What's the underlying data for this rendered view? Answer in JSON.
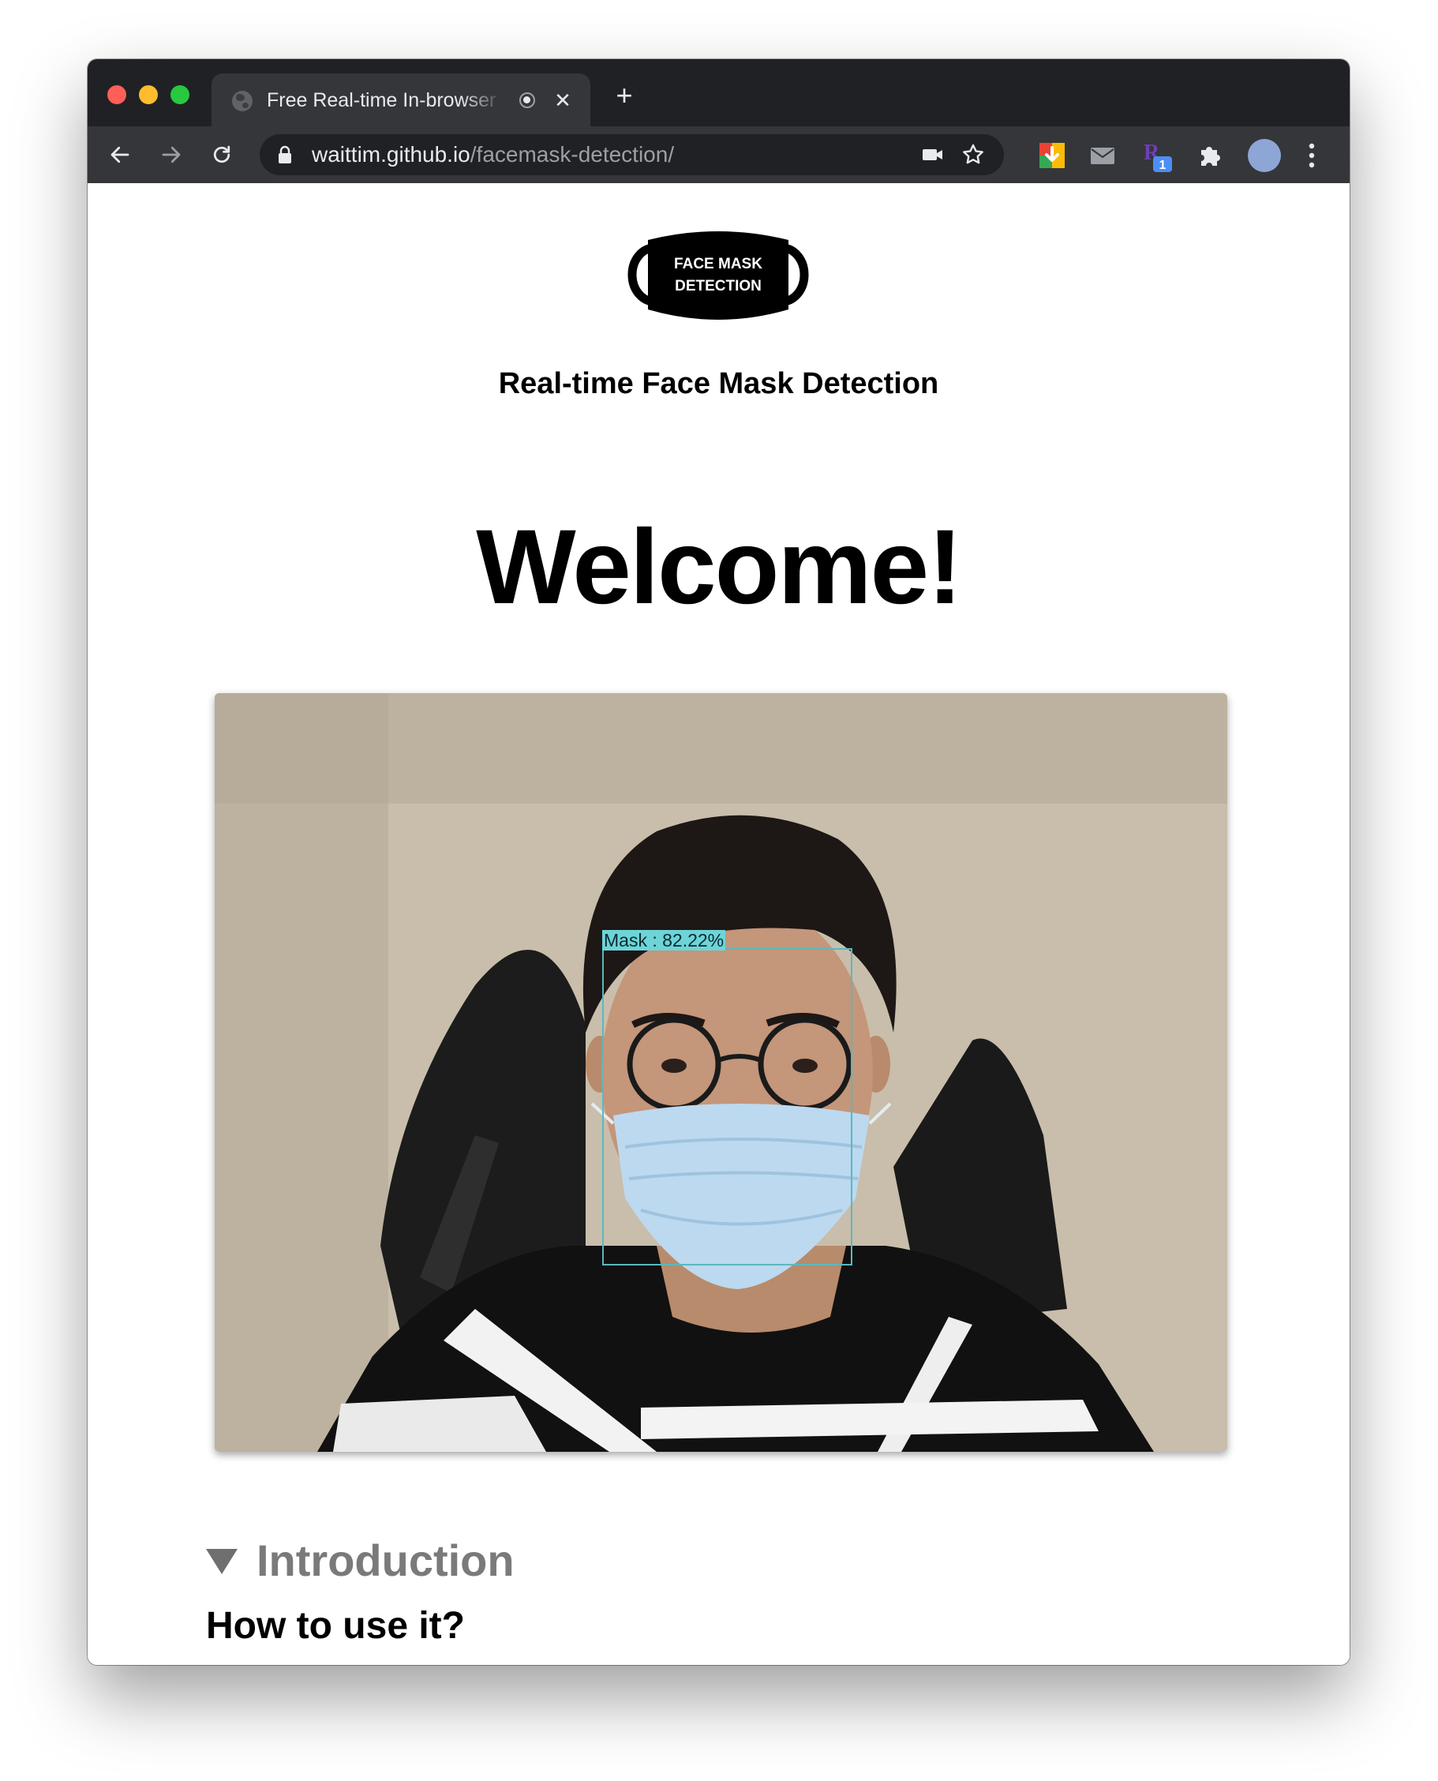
{
  "browser": {
    "tab_title": "Free Real-time In-browser",
    "new_tab_label": "+",
    "close_label": "✕",
    "url_host": "waittim.github.io",
    "url_path": "/facemask-detection/",
    "extension_badge": "1"
  },
  "page": {
    "logo_line1": "FACE MASK",
    "logo_line2": "DETECTION",
    "subtitle": "Real-time Face Mask Detection",
    "heading": "Welcome!",
    "detection_label": "Mask : 82.22%",
    "intro_label": "Introduction",
    "howto_heading": "How to use it?"
  },
  "icons": {
    "back": "arrow-left-icon",
    "forward": "arrow-right-icon",
    "reload": "reload-icon",
    "lock": "lock-icon",
    "camera": "video-camera-icon",
    "bookmark": "star-icon",
    "extensions": "puzzle-icon",
    "menu": "more-vert-icon"
  },
  "colors": {
    "tabstrip": "#202124",
    "toolbar": "#35363a",
    "detection_box": "#5ab8c0",
    "intro_text": "#7a7a7a"
  }
}
